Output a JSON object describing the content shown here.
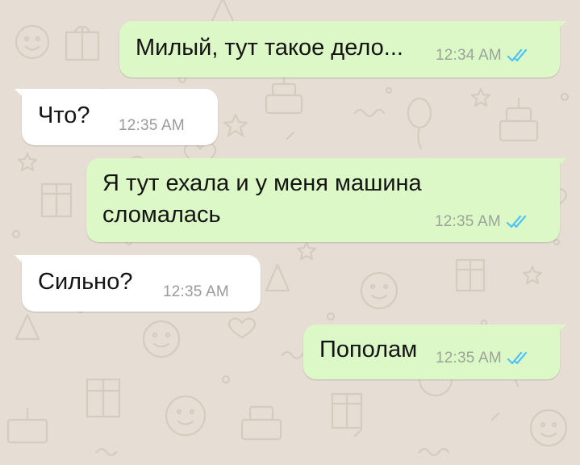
{
  "colors": {
    "background": "#e6ddd4",
    "outgoing_bubble": "#dcf8c6",
    "incoming_bubble": "#ffffff",
    "read_ticks": "#4fc3f7",
    "timestamp": "#9a9a9a"
  },
  "messages": [
    {
      "direction": "outgoing",
      "text": "Милый, тут такое дело...",
      "time": "12:34 AM",
      "status_icon": "double-check-read-icon"
    },
    {
      "direction": "incoming",
      "text": "Что?",
      "time": "12:35 AM"
    },
    {
      "direction": "outgoing",
      "text": "Я тут ехала и у меня машина\nсломалась",
      "time": "12:35 AM",
      "status_icon": "double-check-read-icon"
    },
    {
      "direction": "incoming",
      "text": "Сильно?",
      "time": "12:35 AM"
    },
    {
      "direction": "outgoing",
      "text": "Пополам",
      "time": "12:35 AM",
      "status_icon": "double-check-read-icon"
    }
  ]
}
